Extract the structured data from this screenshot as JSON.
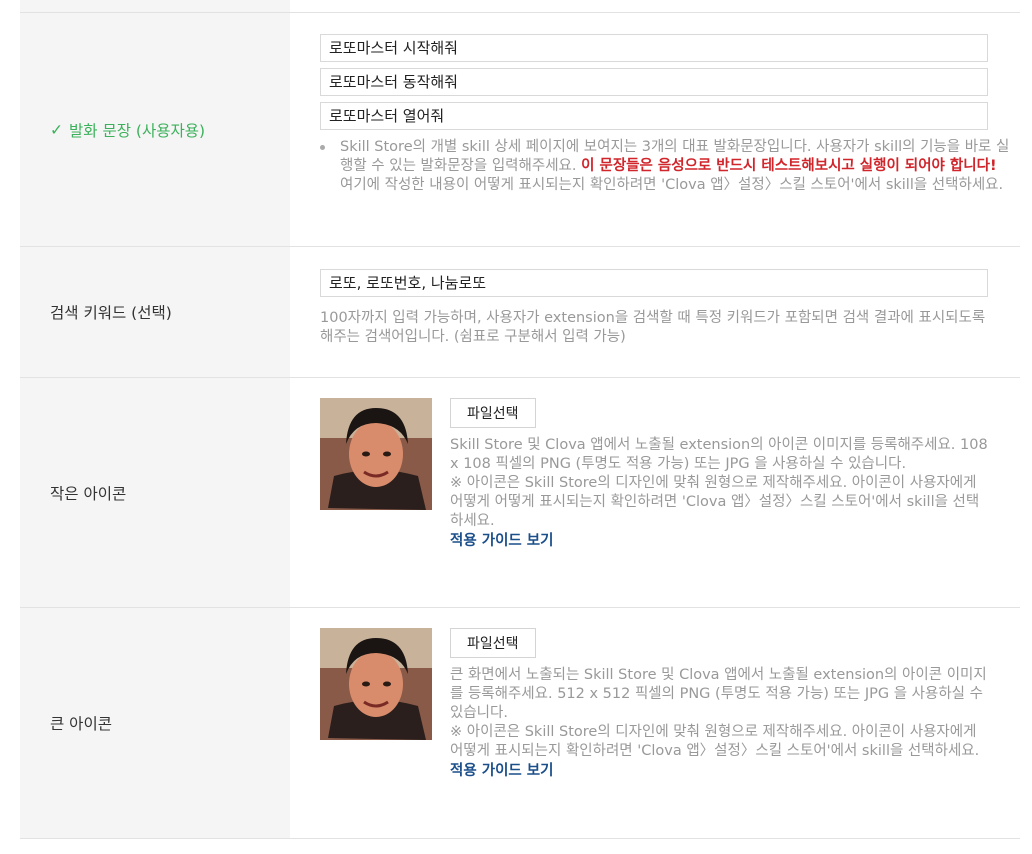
{
  "utterance": {
    "label_check": "✓",
    "label": "발화 문장 (사용자용)",
    "inputs": [
      "로또마스터 시작해줘",
      "로또마스터  동작해줘",
      "로또마스터  열어줘"
    ],
    "help_normal": "Skill Store의 개별 skill 상세 페이지에 보여지는 3개의 대표 발화문장입니다. 사용자가 skill의 기능을 바로 실행할 수 있는 발화문장을 입력해주세요. ",
    "help_warning": "이 문장들은 음성으로 반드시 테스트해보시고 실행이 되어야 합니다!",
    "help_tail": " 여기에 작성한 내용이 어떻게 표시되는지 확인하려면 'Clova 앱〉설정〉스킬 스토어'에서 skill을 선택하세요."
  },
  "keywords": {
    "label": "검색 키워드 (선택)",
    "value": "로또, 로또번호, 나눔로또",
    "help": "100자까지 입력 가능하며, 사용자가 extension을 검색할 때 특정 키워드가 포함되면 검색 결과에 표시되도록 해주는 검색어입니다. (쉼표로 구분해서 입력 가능)"
  },
  "small_icon": {
    "label": "작은 아이콘",
    "file_button": "파일선택",
    "help1": "Skill Store 및 Clova 앱에서 노출될 extension의 아이콘 이미지를 등록해주세요. 108 x 108 픽셀의 PNG (투명도 적용 가능) 또는 JPG 을 사용하실 수 있습니다.",
    "help2": "※ 아이콘은 Skill Store의 디자인에 맞춰 원형으로 제작해주세요. 아이콘이 사용자에게 어떻게 어떻게 표시되는지 확인하려면 'Clova 앱〉설정〉스킬 스토어'에서 skill을 선택하세요.",
    "guide_link": "적용 가이드 보기"
  },
  "large_icon": {
    "label": "큰 아이콘",
    "file_button": "파일선택",
    "help1": "큰 화면에서 노출되는 Skill Store 및 Clova 앱에서 노출될 extension의 아이콘 이미지를 등록해주세요. 512 x 512 픽셀의 PNG (투명도 적용 가능) 또는 JPG 을 사용하실 수 있습니다.",
    "help2": "※ 아이콘은 Skill Store의 디자인에 맞춰 원형으로 제작해주세요. 아이콘이 사용자에게 어떻게 표시되는지 확인하려면 'Clova 앱〉설정〉스킬 스토어'에서 skill을 선택하세요.",
    "guide_link": "적용 가이드 보기"
  },
  "colors": {
    "accent_green": "#3cb15b",
    "warning_red": "#d0252b",
    "link_blue": "#1b4f8a",
    "label_bg": "#f5f5f5"
  }
}
